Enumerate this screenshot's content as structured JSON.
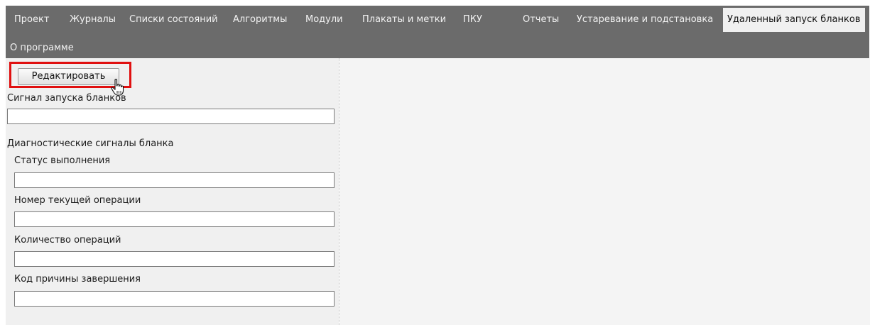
{
  "menu": {
    "items": [
      {
        "label": "Проект"
      },
      {
        "label": "Журналы"
      },
      {
        "label": "Списки состояний"
      },
      {
        "label": "Алгоритмы"
      },
      {
        "label": "Модули"
      },
      {
        "label": "Плакаты и метки"
      },
      {
        "label": "ПКУ"
      },
      {
        "label": "Отчеты"
      },
      {
        "label": "Устаревание и подстановка"
      },
      {
        "label": "Удаленный запуск бланков",
        "active": true
      },
      {
        "label": "О программе"
      }
    ]
  },
  "form": {
    "edit_button": "Редактировать",
    "launch_signal_label": "Сигнал запуска бланков",
    "launch_signal_value": "",
    "diagnostics_heading": "Диагностические сигналы бланка",
    "status_label": "Статус выполнения",
    "status_value": "",
    "current_op_label": "Номер текущей операции",
    "current_op_value": "",
    "op_count_label": "Количество операций",
    "op_count_value": "",
    "reason_code_label": "Код причины завершения",
    "reason_code_value": ""
  },
  "colors": {
    "menubar_bg": "#6b6b6b",
    "highlight": "#e01010"
  },
  "icons": {
    "cursor": "hand-pointer-icon"
  }
}
